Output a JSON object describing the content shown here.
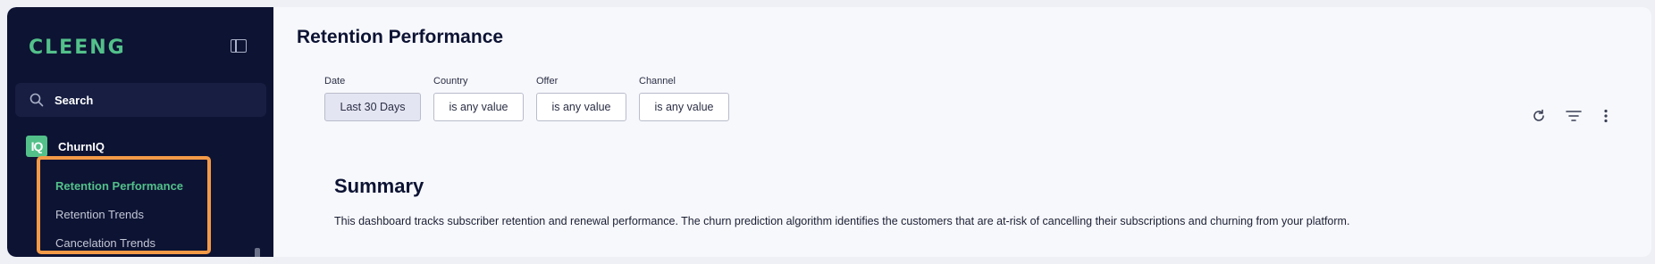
{
  "brand": {
    "logo_text": "CLEENG",
    "accent": "#53c08a",
    "sidebar_bg": "#0d1333"
  },
  "sidebar": {
    "toggle_icon": "sidebar-toggle-icon",
    "search": {
      "label": "Search",
      "icon": "search-icon"
    },
    "product": {
      "badge": "IQ",
      "label": "ChurnIQ"
    },
    "items": [
      {
        "label": "Retention Performance",
        "active": true
      },
      {
        "label": "Retention Trends",
        "active": false
      },
      {
        "label": "Cancelation Trends",
        "active": false
      }
    ]
  },
  "main": {
    "title": "Retention Performance",
    "filters": [
      {
        "label": "Date",
        "value": "Last 30 Days"
      },
      {
        "label": "Country",
        "value": "is any value"
      },
      {
        "label": "Offer",
        "value": "is any value"
      },
      {
        "label": "Channel",
        "value": "is any value"
      }
    ],
    "toolbar": [
      "refresh-icon",
      "filter-icon",
      "more-vertical-icon"
    ],
    "summary": {
      "heading": "Summary",
      "text": "This dashboard tracks subscriber retention and renewal performance. The churn prediction algorithm identifies the customers that are at-risk of cancelling their subscriptions and churning from your platform."
    }
  },
  "highlight_color": "#f39a47"
}
